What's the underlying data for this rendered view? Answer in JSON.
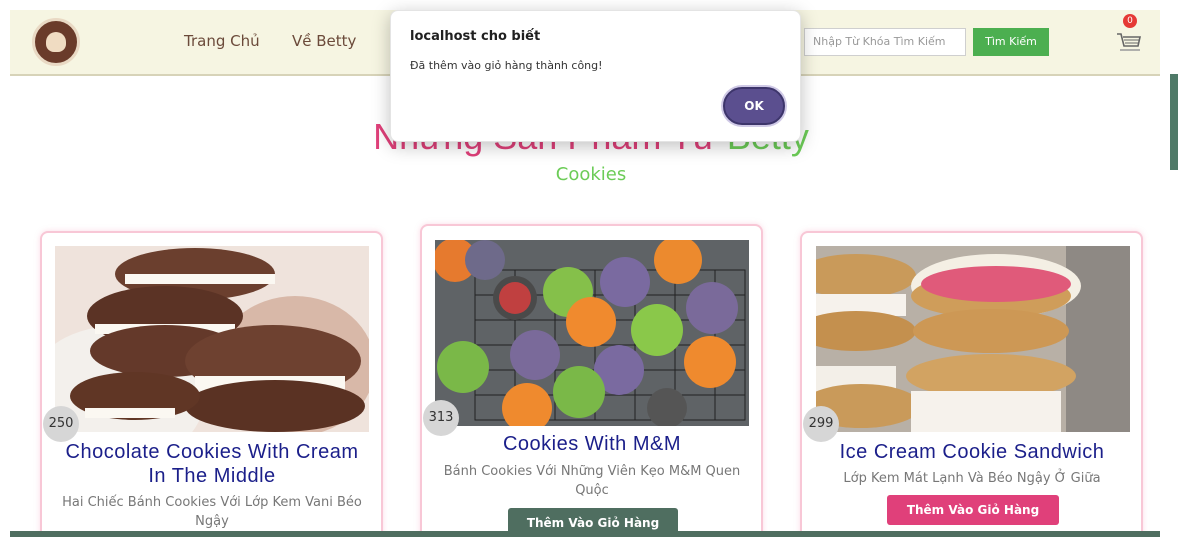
{
  "header": {
    "nav": [
      "Trang Chủ",
      "Về Betty"
    ],
    "search_placeholder": "Nhập Từ Khóa Tìm Kiếm",
    "search_button": "Tìm Kiếm",
    "cart_count": "0"
  },
  "section": {
    "title_part1": "Những Sản Phẩm Từ ",
    "title_part2": "Betty",
    "subtitle": "Cookies"
  },
  "products": [
    {
      "price": "250",
      "name": "Chocolate Cookies With Cream In The Middle",
      "desc": "Hai Chiếc Bánh Cookies Với Lớp Kem Vani Béo Ngậy",
      "button": ""
    },
    {
      "price": "313",
      "name": "Cookies With M&M",
      "desc": "Bánh Cookies Với Những Viên Kẹo M&M Quen Quộc",
      "button": "Thêm Vào Giỏ Hàng"
    },
    {
      "price": "299",
      "name": "Ice Cream Cookie Sandwich",
      "desc": "Lớp Kem Mát Lạnh Và Béo Ngậy Ở Giữa",
      "button": "Thêm Vào Giỏ Hàng"
    }
  ],
  "dialog": {
    "title": "localhost cho biết",
    "message": "Đã thêm vào giỏ hàng thành công!",
    "ok": "OK"
  },
  "colors": {
    "accent_pink": "#e0407a",
    "accent_green": "#6ccc57",
    "button_teal": "#4f6e60",
    "dialog_button": "#5b4f8f"
  }
}
